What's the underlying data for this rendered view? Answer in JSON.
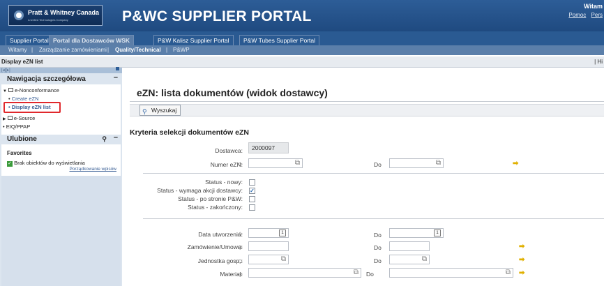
{
  "header": {
    "logo_text": "Pratt & Whitney Canada",
    "logo_subtext": "A United Technologies Company",
    "portal_title": "P&WC SUPPLIER PORTAL",
    "user_name": "Witam",
    "help_link": "Pomoc",
    "personalize_link": "Pers"
  },
  "tabs": [
    "Supplier Portal",
    "Portal dla Dostawców WSK",
    "P&W Kalisz Supplier Portal",
    "P&W Tubes Supplier Portal"
  ],
  "subnav": {
    "items": [
      "Witamy",
      "Zarządzanie zamówieniami",
      "Quality/Technical",
      "P&WP"
    ],
    "active": "Quality/Technical"
  },
  "breadcrumb": {
    "current": "Display eZN list",
    "right": "| Hi"
  },
  "sidebar": {
    "top_controls": "[◂][▸]",
    "nav_title": "Nawigacja szczegółowa",
    "nav_items": [
      {
        "label": "e-Nonconformance",
        "type": "folder-open"
      },
      {
        "label": "Create eZN",
        "type": "link"
      },
      {
        "label": "Display eZN list",
        "type": "link-active"
      },
      {
        "label": "e-Source",
        "type": "folder"
      },
      {
        "label": "EIQ/PPAP",
        "type": "item"
      }
    ],
    "favorites_title": "Ulubione",
    "favorites_label": "Favorites",
    "favorites_empty": "Brak obiektów do wyświetlania",
    "sort_link": "Porządkowanie wpisów"
  },
  "main": {
    "page_title": "eZN: lista dokumentów (widok dostawcy)",
    "search_button": "Wyszukaj",
    "section_title": "Kryteria selekcji dokumentów eZN",
    "fields": {
      "dostawca_label": "Dostawca:",
      "dostawca_value": "2000097",
      "numer_label": "Numer eZN:",
      "do_label": "Do",
      "status_new": "Status - nowy:",
      "status_action": "Status - wymaga akcji dostawcy:",
      "status_pw": "Status - po stronie P&W:",
      "status_done": "Status - zakończony:",
      "data_label": "Data utworzenia:",
      "zam_label": "Zamówienie/Umowa:",
      "jedn_label": "Jednostka gosp.:",
      "material_label": "Materiał:"
    },
    "checkboxes": {
      "status_new": false,
      "status_action": true,
      "status_pw": false,
      "status_done": false
    }
  },
  "colors": {
    "header_bg": "#1f4a80",
    "tab_active": "#5c7ea8",
    "sidebar_bg": "#dce5ef",
    "highlight_red": "#e0282c",
    "arrow_yellow": "#e0b000"
  }
}
